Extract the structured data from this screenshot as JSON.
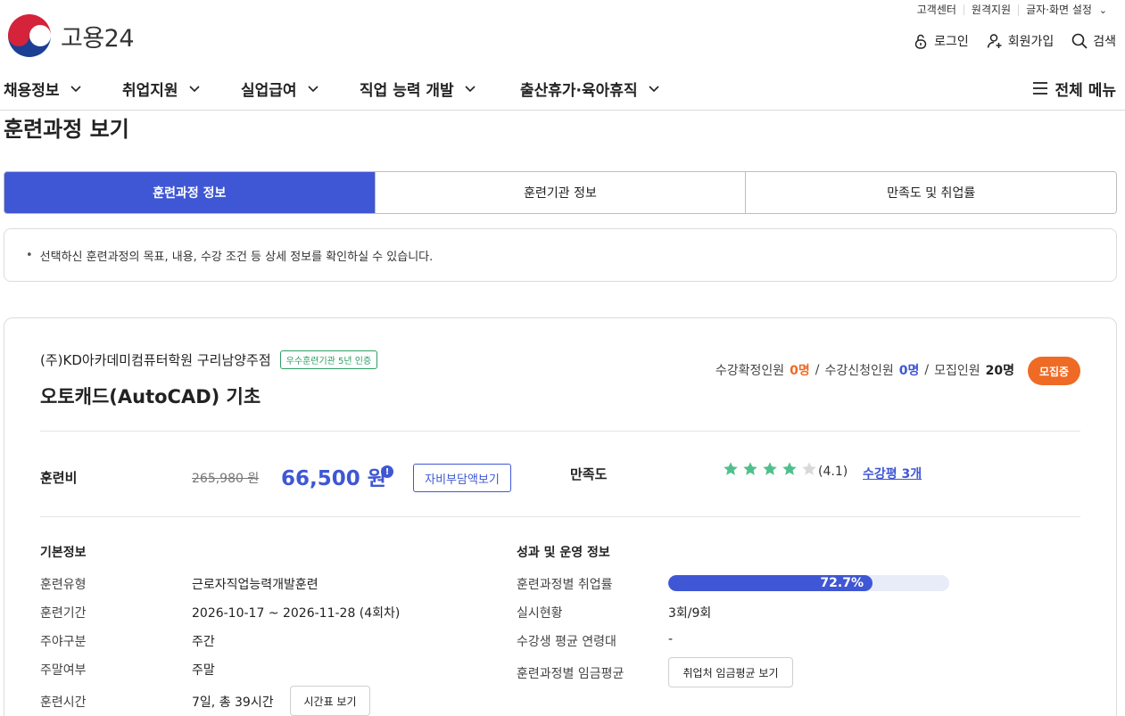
{
  "brand": {
    "logo_text": "고용24"
  },
  "top_util": {
    "customer_center": "고객센터",
    "remote_support": "원격지원",
    "display_settings": "글자·화면 설정"
  },
  "account": {
    "login": "로그인",
    "signup": "회원가입",
    "search": "검색"
  },
  "gnb": {
    "items": [
      "채용정보",
      "취업지원",
      "실업급여",
      "직업 능력 개발",
      "출산휴가·육아휴직"
    ],
    "all_menu": "전체 메뉴"
  },
  "page_title": "훈련과정 보기",
  "tabs": [
    "훈련과정 정보",
    "훈련기관 정보",
    "만족도 및 취업률"
  ],
  "notice": "선택하신 훈련과정의 목표, 내용, 수강 조건 등 상세 정보를 확인하실 수 있습니다.",
  "course": {
    "institution": "(주)KD아카데미컴퓨터학원 구리남양주점",
    "cert_badge": "우수훈련기관 5년 인증",
    "title": "오토캐드(AutoCAD) 기초",
    "confirmed_label": "수강확정인원",
    "confirmed_value": "0명",
    "applied_label": "수강신청인원",
    "applied_value": "0명",
    "capacity_label": "모집인원",
    "capacity_value": "20명",
    "status": "모집중",
    "fee_label": "훈련비",
    "fee_original": "265,980 원",
    "fee_price": "66,500 원",
    "self_pay_button": "자비부담액보기",
    "satisfaction_label": "만족도",
    "rating_value": 4.1,
    "rating_text": "(4.1)",
    "reviews_link": "수강평 3개"
  },
  "basic_info": {
    "title": "기본정보",
    "rows": [
      {
        "label": "훈련유형",
        "value": "근로자직업능력개발훈련"
      },
      {
        "label": "훈련기간",
        "value": "2026-10-17 ~ 2026-11-28 (4회차)"
      },
      {
        "label": "주야구분",
        "value": "주간"
      },
      {
        "label": "주말여부",
        "value": "주말"
      },
      {
        "label": "훈련시간",
        "value": "7일, 총 39시간"
      }
    ],
    "timetable_button": "시간표 보기"
  },
  "performance": {
    "title": "성과 및 운영 정보",
    "employment_label": "훈련과정별 취업률",
    "employment_rate": 72.7,
    "employment_rate_text": "72.7%",
    "status_label": "실시현황",
    "status_value": "3회/9회",
    "age_label": "수강생 평균 연령대",
    "age_value": "-",
    "wage_label": "훈련과정별 임금평균",
    "wage_button": "취업처 임금평균 보기"
  },
  "colors": {
    "primary": "#3f57d4",
    "orange": "#ef6a25",
    "green": "#2e9d63",
    "star": "#4fc08d"
  }
}
